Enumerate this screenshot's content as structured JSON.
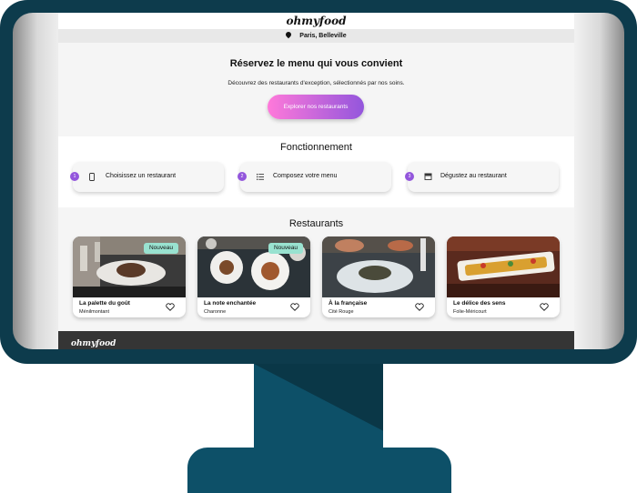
{
  "header": {
    "logo": "ohmyfood"
  },
  "location": {
    "city": "Paris, Belleville",
    "icon": "map-pin-icon"
  },
  "hero": {
    "title": "Réservez le menu qui vous convient",
    "subtitle": "Découvrez des restaurants d'exception, sélectionnés par nos soins.",
    "cta_label": "Explorer nos restaurants"
  },
  "how": {
    "title": "Fonctionnement",
    "steps": [
      {
        "num": "1",
        "label": "Choisissez un restaurant",
        "icon": "mobile-phone-icon"
      },
      {
        "num": "2",
        "label": "Composez votre menu",
        "icon": "list-icon"
      },
      {
        "num": "3",
        "label": "Dégustez au restaurant",
        "icon": "store-icon"
      }
    ]
  },
  "restaurants": {
    "title": "Restaurants",
    "items": [
      {
        "name": "La palette du goût",
        "area": "Ménilmontant",
        "badge": "Nouveau"
      },
      {
        "name": "La note enchantée",
        "area": "Charonne",
        "badge": "Nouveau"
      },
      {
        "name": "À la française",
        "area": "Cité Rouge",
        "badge": ""
      },
      {
        "name": "Le délice des sens",
        "area": "Folie-Méricourt",
        "badge": ""
      }
    ]
  },
  "footer": {
    "logo": "ohmyfood"
  },
  "colors": {
    "accent_pink": "#ff79da",
    "accent_purple": "#9356dc",
    "badge_green": "#99e2d0",
    "monitor": "#0d3b4c"
  }
}
